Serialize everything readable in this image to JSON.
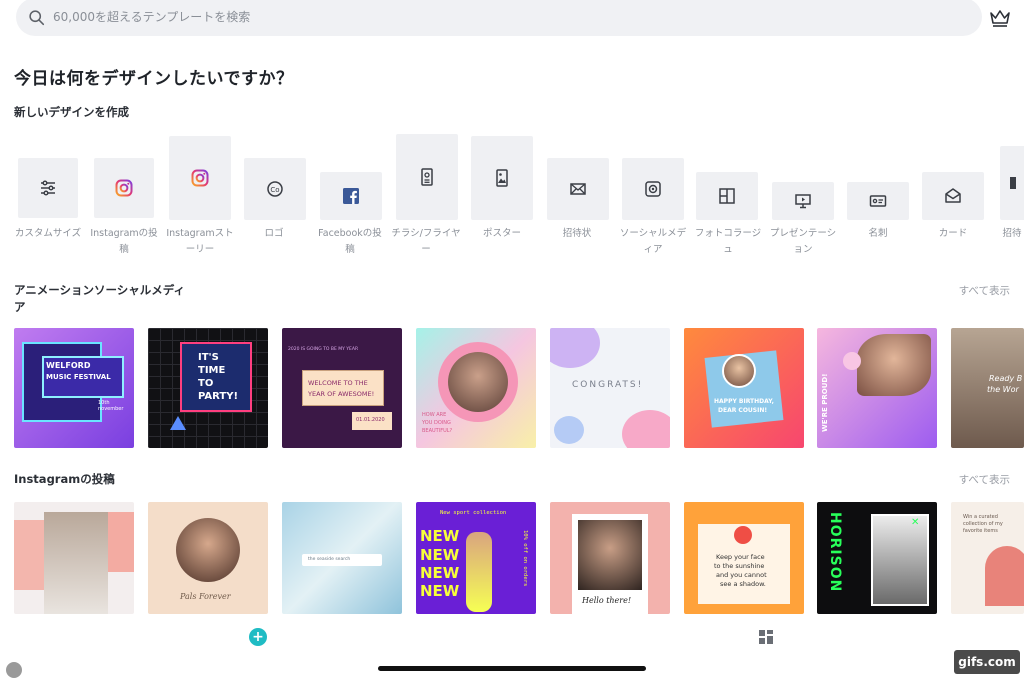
{
  "search": {
    "placeholder": "60,000を超えるテンプレートを検索"
  },
  "heading": "今日は何をデザインしたいですか？",
  "create_title": "新しいデザインを作成",
  "design_types": [
    {
      "label": "カスタムサイズ",
      "icon": "sliders-icon"
    },
    {
      "label": "Instagramの投稿",
      "icon": "instagram-icon"
    },
    {
      "label": "Instagramストーリー",
      "icon": "instagram-icon"
    },
    {
      "label": "ロゴ",
      "icon": "copyright-icon"
    },
    {
      "label": "Facebookの投稿",
      "icon": "facebook-icon"
    },
    {
      "label": "チラシ/フライヤー",
      "icon": "flyer-icon"
    },
    {
      "label": "ポスター",
      "icon": "poster-icon"
    },
    {
      "label": "招待状",
      "icon": "envelope-icon"
    },
    {
      "label": "ソーシャルメディア",
      "icon": "social-media-icon"
    },
    {
      "label": "フォトコラージュ",
      "icon": "collage-icon"
    },
    {
      "label": "プレゼンテーション",
      "icon": "presentation-icon"
    },
    {
      "label": "名刺",
      "icon": "business-card-icon"
    },
    {
      "label": "カード",
      "icon": "card-icon"
    },
    {
      "label": "招待",
      "icon": "invitation-icon"
    }
  ],
  "sections": {
    "animated": {
      "title": "アニメーションソーシャルメディア",
      "see_all": "すべて表示",
      "templates": [
        {
          "lines": [
            "WELFORD",
            "MUSIC FESTIVAL"
          ],
          "extra": "10th november"
        },
        {
          "lines": [
            "IT'S",
            "TIME",
            "TO",
            "PARTY!"
          ]
        },
        {
          "lines": [
            "2020 IS GOING TO BE MY YEAR",
            "WELCOME TO THE",
            "YEAR OF AWESOME!",
            "01.01.2020"
          ]
        },
        {
          "lines": [
            "HOW ARE",
            "YOU DOING",
            "BEAUTIFUL?"
          ]
        },
        {
          "lines": [
            "CONGRATS!"
          ]
        },
        {
          "lines": [
            "HAPPY BIRTHDAY,",
            "DEAR COUSIN!"
          ]
        },
        {
          "lines": [
            "WE'RE PROUD!"
          ]
        },
        {
          "lines": [
            "Ready B",
            "the Wor"
          ]
        }
      ]
    },
    "instagram": {
      "title": "Instagramの投稿",
      "see_all": "すべて表示",
      "templates": [
        {
          "lines": []
        },
        {
          "lines": [
            "Pals Forever"
          ]
        },
        {
          "lines": [
            "the seaside search"
          ]
        },
        {
          "lines": [
            "New sport collection",
            "NEW",
            "10% off on orders"
          ]
        },
        {
          "lines": [
            "Hello there!"
          ]
        },
        {
          "lines": [
            "Keep your face",
            "to the sunshine",
            "and you cannot",
            "see a shadow."
          ]
        },
        {
          "lines": [
            "HORISON"
          ]
        },
        {
          "lines": [
            "Win a curated",
            "collection of my",
            "favorite items"
          ]
        }
      ]
    }
  },
  "watermark": "gifs.com",
  "colors": {
    "accent": "#1fbcc4",
    "tile": "#eff0f3",
    "label": "#8b9098"
  }
}
